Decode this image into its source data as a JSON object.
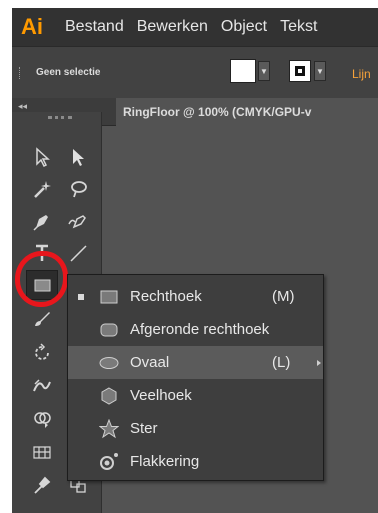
{
  "app": {
    "logo": "Ai"
  },
  "menubar": {
    "items": [
      "Bestand",
      "Bewerken",
      "Object",
      "Tekst"
    ]
  },
  "controlbar": {
    "selection_label": "Geen selectie",
    "cut_label": "Lijn"
  },
  "document": {
    "tab_title": "RingFloor @ 100% (CMYK/GPU-v"
  },
  "toolbar": {
    "collapse": "◂◂",
    "tools": [
      "selection-tool",
      "direct-selection-tool",
      "magic-wand-tool",
      "lasso-tool",
      "pen-tool",
      "curvature-tool",
      "type-tool",
      "line-segment-tool",
      "rectangle-tool",
      "paintbrush-tool",
      "rotate-tool",
      "width-tool",
      "shape-builder-tool",
      "perspective-grid-tool",
      "eyedropper-tool",
      "blend-tool"
    ]
  },
  "flyout": {
    "items": [
      {
        "label": "Rechthoek",
        "shortcut": "(M)",
        "icon": "rectangle-icon",
        "selected": true
      },
      {
        "label": "Afgeronde rechthoek",
        "shortcut": "",
        "icon": "rounded-rectangle-icon"
      },
      {
        "label": "Ovaal",
        "shortcut": "(L)",
        "icon": "ellipse-icon",
        "hover": true
      },
      {
        "label": "Veelhoek",
        "shortcut": "",
        "icon": "polygon-icon"
      },
      {
        "label": "Ster",
        "shortcut": "",
        "icon": "star-icon"
      },
      {
        "label": "Flakkering",
        "shortcut": "",
        "icon": "flare-icon"
      }
    ]
  },
  "colors": {
    "accent": "#ff9a00",
    "annotation": "#e8161c",
    "panel": "#424242",
    "canvas": "#535353"
  }
}
